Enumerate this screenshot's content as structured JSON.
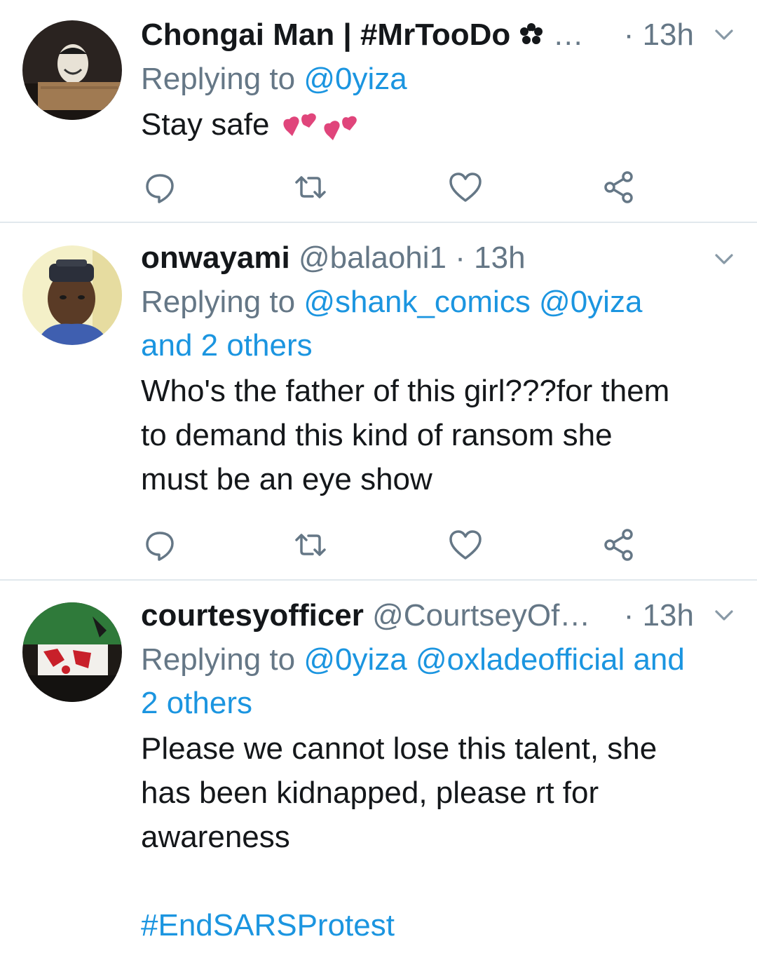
{
  "tweets": [
    {
      "name": "Chongai Man | #MrTooDo",
      "handle": "",
      "truncation": "…",
      "time": "· 13h",
      "replying_prefix": "Replying to",
      "mentions_line1": "@0yiza",
      "mentions_line2": "",
      "text_lines": [
        "Stay safe"
      ],
      "emoji": "💕💕",
      "hashtag": ""
    },
    {
      "name": "onwayami",
      "handle": "@balaohi1",
      "truncation": "",
      "time": "· 13h",
      "replying_prefix": "Replying to",
      "mentions_line1": "@shank_comics @0yiza",
      "mentions_line2": "and 2 others",
      "text_lines": [
        "Who's the father of this girl???for them",
        "to demand this kind of ransom she",
        "must be an eye show"
      ],
      "hashtag": ""
    },
    {
      "name": "courtesyofficer",
      "handle": "@CourtseyOf…",
      "truncation": "",
      "time": "· 13h",
      "replying_prefix": "Replying to",
      "mentions_line1": "@0yiza @oxladeofficial and",
      "mentions_line2": "2 others",
      "text_lines": [
        "Please we cannot lose this talent, she",
        "has been kidnapped, please rt for",
        "awareness"
      ],
      "hashtag": "#EndSARSProtest"
    }
  ],
  "icons": [
    "reply-icon",
    "retweet-icon",
    "like-icon",
    "share-icon",
    "chevron-down-icon"
  ],
  "colors": {
    "link": "#1b95e0",
    "muted": "#657786",
    "text": "#14171a",
    "divider": "#e1e8ed",
    "heart": "#e0457b"
  }
}
